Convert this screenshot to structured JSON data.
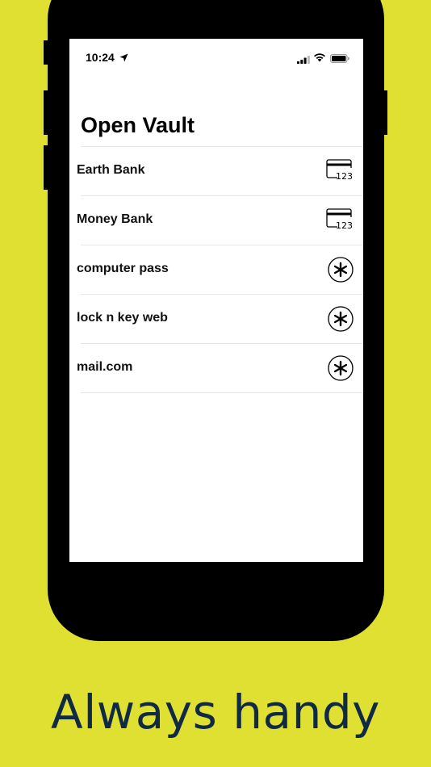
{
  "status_bar": {
    "time": "10:24",
    "icons": [
      "location-arrow-icon",
      "cellular-signal-icon",
      "wifi-icon",
      "battery-icon"
    ]
  },
  "vault": {
    "title": "Open Vault",
    "items": [
      {
        "label": "Earth Bank",
        "icon": "credit-card-icon",
        "icon_text": "123"
      },
      {
        "label": "Money Bank",
        "icon": "credit-card-icon",
        "icon_text": "123"
      },
      {
        "label": "computer pass",
        "icon": "asterisk-icon"
      },
      {
        "label": "lock n key web",
        "icon": "asterisk-icon"
      },
      {
        "label": "mail.com",
        "icon": "asterisk-icon"
      }
    ]
  },
  "tagline": "Always handy",
  "colors": {
    "background": "#e0e033",
    "tagline": "#102a45",
    "device": "#000000",
    "screen": "#ffffff"
  }
}
